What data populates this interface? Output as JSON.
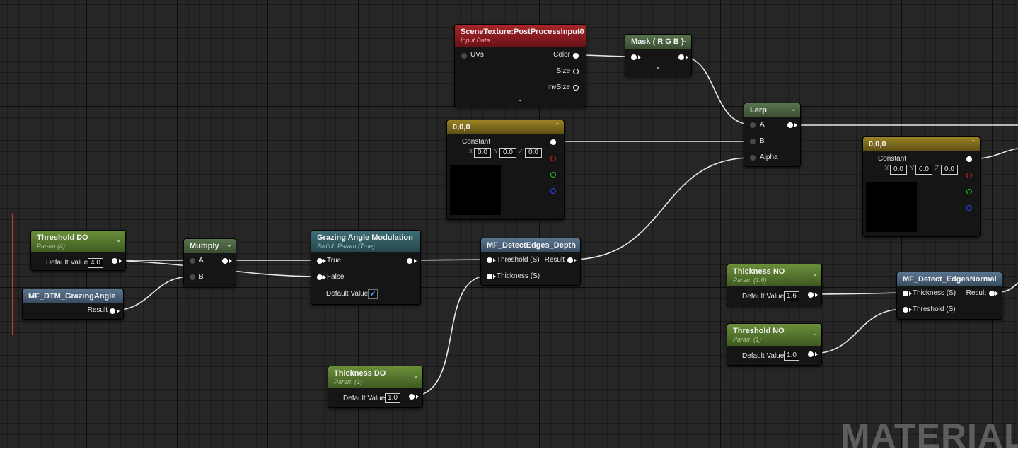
{
  "watermark": "MATERIAL",
  "nodes": {
    "scene_texture": {
      "title": "SceneTexture:PostProcessInput0",
      "subtitle": "Input Data",
      "pins": {
        "uvs": "UVs",
        "color": "Color",
        "size": "Size",
        "invsize": "InvSize"
      }
    },
    "mask": {
      "title": "Mask ( R G B )"
    },
    "lerp": {
      "title": "Lerp",
      "pins": {
        "a": "A",
        "b": "B",
        "alpha": "Alpha"
      }
    },
    "constant_1": {
      "title": "0,0,0",
      "output_label": "Constant",
      "x_label": "X",
      "x_value": "0.0",
      "y_label": "Y",
      "y_value": "0.0",
      "z_label": "Z",
      "z_value": "0.0"
    },
    "constant_2": {
      "title": "0,0,0",
      "output_label": "Constant",
      "x_label": "X",
      "x_value": "0.0",
      "y_label": "Y",
      "y_value": "0.0",
      "z_label": "Z",
      "z_value": "0.0"
    },
    "threshold_do": {
      "title": "Threshold DO",
      "subtitle": "Param (4)",
      "default_label": "Default Value",
      "value": "4.0"
    },
    "multiply": {
      "title": "Multiply",
      "pins": {
        "a": "A",
        "b": "B"
      }
    },
    "grazing": {
      "title": "Grazing Angle Modulation",
      "subtitle": "Switch Param (True)",
      "pins": {
        "true": "True",
        "false": "False"
      },
      "default_label": "Default Value",
      "checked": true
    },
    "mf_grazing": {
      "title": "MF_DTM_GrazingAngle",
      "result_label": "Result"
    },
    "detect_depth": {
      "title": "MF_DetectEdges_Depth",
      "pins": {
        "threshold": "Threshold (S)",
        "thickness": "Thickness (S)",
        "result": "Result"
      }
    },
    "thickness_do": {
      "title": "Thickness DO",
      "subtitle": "Param (1)",
      "default_label": "Default Value",
      "value": "1.0"
    },
    "thickness_no": {
      "title": "Thickness NO",
      "subtitle": "Param (1.6)",
      "default_label": "Default Value",
      "value": "1.6"
    },
    "threshold_no": {
      "title": "Threshold NO",
      "subtitle": "Param (1)",
      "default_label": "Default Value",
      "value": "1.0"
    },
    "detect_normal": {
      "title": "MF_Detect_EdgesNormal",
      "pins": {
        "thickness": "Thickness (S)",
        "threshold": "Threshold (S)",
        "result": "Result"
      }
    }
  },
  "colors": {
    "canvas": "#262626",
    "wire": "#e8e8e8",
    "selection": "#c8383a",
    "param_header": "#4e6e2e",
    "texture_header": "#8a1c20",
    "function_header": "#4a6278",
    "constant_header": "#7a6a1c",
    "switch_header": "#32585e"
  },
  "icons": {
    "collapse": "chevron-down-icon",
    "expand": "chevron-up-icon",
    "checkbox": "checkmark-icon"
  }
}
